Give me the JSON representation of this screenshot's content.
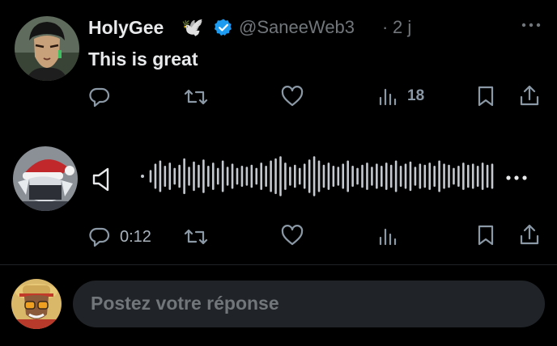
{
  "tweet": {
    "author_name": "HolyGee",
    "author_emoji": "🕊️",
    "handle": "@SaneeWeb3",
    "separator": "·",
    "time": "2 j",
    "text": "This is great",
    "views": "18"
  },
  "audio_post": {
    "duration": "0:12",
    "waveform_levels": [
      0.25,
      0.55,
      0.7,
      0.45,
      0.6,
      0.35,
      0.5,
      0.8,
      0.4,
      0.65,
      0.5,
      0.75,
      0.45,
      0.6,
      0.35,
      0.7,
      0.4,
      0.55,
      0.35,
      0.45,
      0.4,
      0.5,
      0.35,
      0.6,
      0.45,
      0.7,
      0.8,
      0.9,
      0.6,
      0.4,
      0.5,
      0.35,
      0.55,
      0.75,
      0.9,
      0.7,
      0.5,
      0.6,
      0.45,
      0.4,
      0.55,
      0.7,
      0.45,
      0.35,
      0.5,
      0.6,
      0.4,
      0.55,
      0.45,
      0.6,
      0.5,
      0.7,
      0.45,
      0.55,
      0.65,
      0.4,
      0.55,
      0.5,
      0.6,
      0.45,
      0.7,
      0.55,
      0.5,
      0.35,
      0.45,
      0.6,
      0.5,
      0.55,
      0.45,
      0.6,
      0.5,
      0.55
    ]
  },
  "reply": {
    "placeholder": "Postez votre réponse"
  },
  "colors": {
    "icon": "#8b98a5",
    "verified": "#1d9bf0",
    "waveform": "#c4c9cf"
  }
}
